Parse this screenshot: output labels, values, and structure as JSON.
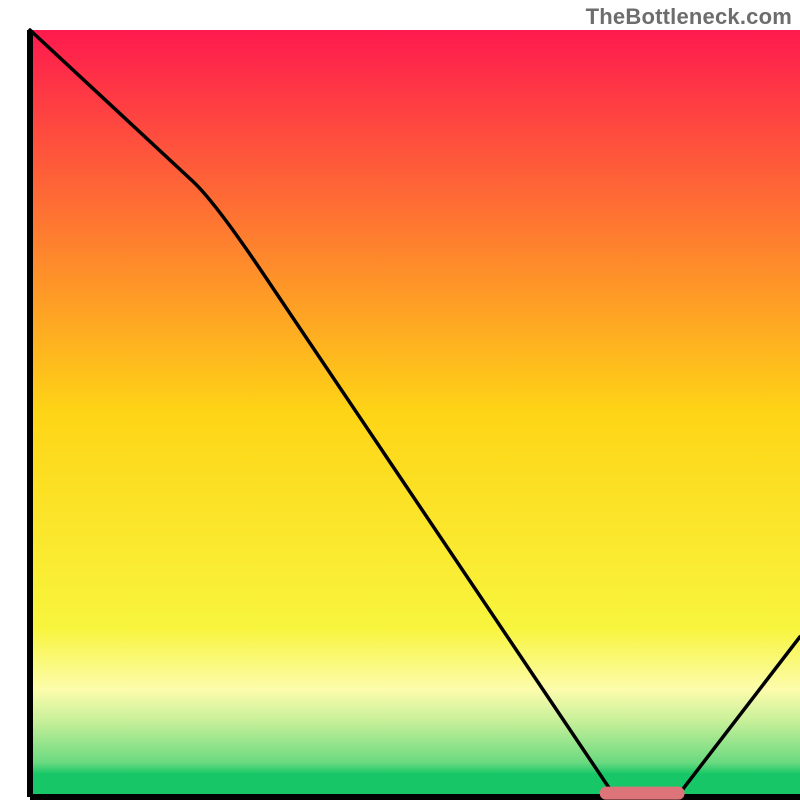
{
  "attribution": "TheBottleneck.com",
  "chart_data": {
    "type": "line",
    "title": "",
    "xlabel": "",
    "ylabel": "",
    "xlim": [
      0,
      100
    ],
    "ylim": [
      0,
      100.5
    ],
    "x": [
      0,
      24,
      76,
      84,
      100
    ],
    "values": [
      100.5,
      78,
      0,
      0,
      21
    ],
    "marker": {
      "x_range": [
        74,
        85
      ],
      "y": 0.5,
      "color": "#dc7479"
    },
    "background_gradient": {
      "stops": [
        {
          "offset": 0.0,
          "color": "#fe1a4e"
        },
        {
          "offset": 0.25,
          "color": "#fe7631"
        },
        {
          "offset": 0.5,
          "color": "#fed516"
        },
        {
          "offset": 0.78,
          "color": "#f8f53e"
        },
        {
          "offset": 0.86,
          "color": "#fcfcac"
        },
        {
          "offset": 0.9,
          "color": "#c9f09a"
        },
        {
          "offset": 0.955,
          "color": "#6ada80"
        },
        {
          "offset": 0.97,
          "color": "#17c767"
        },
        {
          "offset": 1.0,
          "color": "#17c767"
        }
      ]
    },
    "axes": {
      "left": {
        "x": 3.75,
        "y0": 3.75,
        "y1": 99.6
      },
      "bottom": {
        "y": 99.6,
        "x0": 3.75,
        "x1": 100
      }
    }
  }
}
